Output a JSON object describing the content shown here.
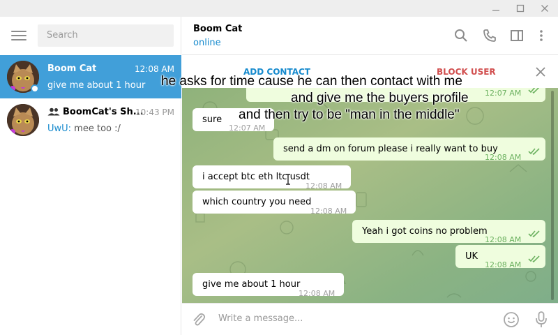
{
  "window": {
    "minimize_glyph": "—",
    "maximize_glyph": "☐",
    "close_glyph": "✕"
  },
  "sidebar": {
    "search_placeholder": "Search",
    "chats": [
      {
        "name": "Boom Cat",
        "time": "12:08 AM",
        "preview": "give me about 1 hour",
        "selected": true,
        "online": true
      },
      {
        "name": "BoomCat's Sh...",
        "time": "10:43 PM",
        "preview_sender": "UwU:",
        "preview": " mee too :/",
        "is_group": true
      }
    ]
  },
  "header": {
    "name": "Boom Cat",
    "status": "online",
    "icons": [
      "search-icon",
      "phone-icon",
      "side-panel-icon",
      "more-icon"
    ]
  },
  "action_bar": {
    "add_contact": "ADD CONTACT",
    "block_user": "BLOCK USER"
  },
  "messages": [
    {
      "direction": "out",
      "text": "",
      "time": "12:07 AM",
      "read": true
    },
    {
      "direction": "in",
      "text": "sure",
      "time": "12:07 AM"
    },
    {
      "direction": "out",
      "text": "send a dm on forum please i really want to buy",
      "time": "12:08 AM",
      "read": true
    },
    {
      "direction": "in",
      "text": "i accept btc eth ltc usdt",
      "time": "12:08 AM"
    },
    {
      "direction": "in",
      "text": "which country you need",
      "time": "12:08 AM"
    },
    {
      "direction": "out",
      "text": "Yeah i got coins no problem",
      "time": "12:08 AM",
      "read": true
    },
    {
      "direction": "out",
      "text": "UK",
      "time": "12:08 AM",
      "read": true
    },
    {
      "direction": "in",
      "text": "give me about 1 hour",
      "time": "12:08 AM"
    }
  ],
  "composer": {
    "placeholder": "Write a message..."
  },
  "overlay_caption": {
    "line1": "he asks for time cause he can then contact with me",
    "line2": "and give me the buyers profile",
    "line3": "and then try to be \"man in the middle\""
  },
  "colors": {
    "accent": "#419fd9",
    "link": "#168acd",
    "block": "#d14e4e",
    "outgoing_bubble": "#effdde",
    "read_check": "#6cb160"
  }
}
